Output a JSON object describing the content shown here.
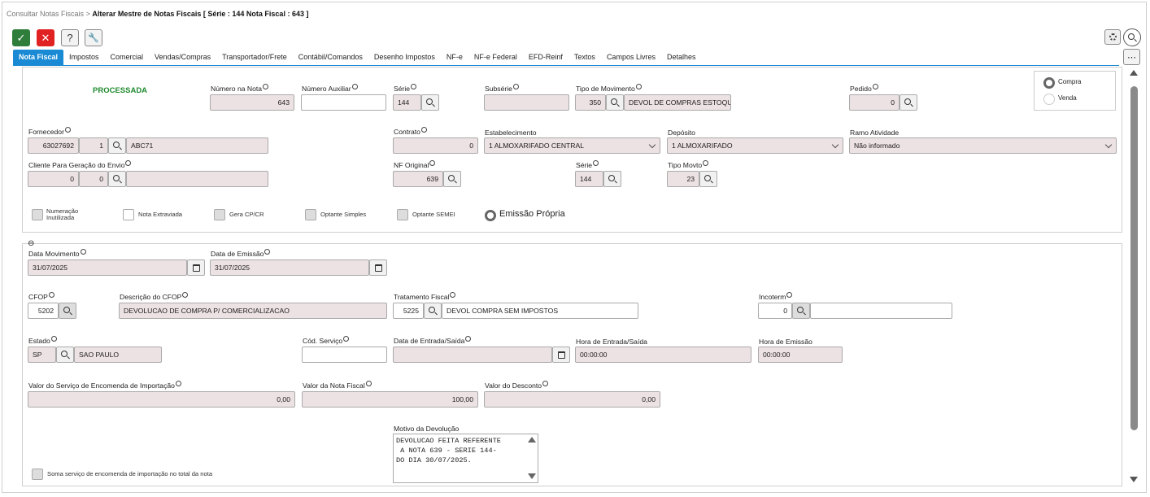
{
  "breadcrumb": {
    "parent": "Consultar Notas Fiscais",
    "sep": ">",
    "current": "Alterar Mestre de Notas Fiscais [ Série : 144 Nota Fiscal : 643 ]"
  },
  "toolbar": {
    "confirm": "✓",
    "cancel": "✕",
    "help": "?",
    "tools": "🔧",
    "more": "⋯"
  },
  "tabs": [
    "Nota Fiscal",
    "Impostos",
    "Comercial",
    "Vendas/Compras",
    "Transportador/Frete",
    "Contábil/Comandos",
    "Desenho Impostos",
    "NF-e",
    "NF-e Federal",
    "EFD-Reinf",
    "Textos",
    "Campos Livres",
    "Detalhes"
  ],
  "header": {
    "status": "PROCESSADA",
    "numero_nota": {
      "label": "Número na Nota",
      "value": "643"
    },
    "numero_auxiliar": {
      "label": "Número Auxiliar",
      "value": ""
    },
    "serie": {
      "label": "Série",
      "value": "144"
    },
    "subserie": {
      "label": "Subsérie",
      "value": ""
    },
    "tipo_movimento": {
      "label": "Tipo de Movimento",
      "code": "350",
      "desc": "DEVOL DE COMPRAS ESTOQUE"
    },
    "pedido": {
      "label": "Pedido",
      "value": "0"
    },
    "radio_compra": "Compra",
    "radio_venda": "Venda",
    "fornecedor": {
      "label": "Fornecedor",
      "code": "63027692",
      "seq": "1",
      "name": "ABC71"
    },
    "contrato": {
      "label": "Contrato",
      "value": "0"
    },
    "estabelecimento": {
      "label": "Estabelecimento",
      "value": "1 ALMOXARIFADO CENTRAL"
    },
    "deposito": {
      "label": "Depósito",
      "value": "1 ALMOXARIFADO"
    },
    "ramo": {
      "label": "Ramo Atividade",
      "value": "Não informado"
    },
    "cliente_envio": {
      "label": "Cliente Para Geração do Envio",
      "code": "0",
      "seq": "0",
      "name": ""
    },
    "nf_original": {
      "label": "NF Original",
      "value": "639"
    },
    "serie2": {
      "label": "Série",
      "value": "144"
    },
    "tipo_movto": {
      "label": "Tipo Movto",
      "value": "23"
    },
    "cb_numeracao_1": "Numeração",
    "cb_numeracao_2": "Inutilizada",
    "cb_extraviada": "Nota Extraviada",
    "cb_gera": "Gera CP/CR",
    "cb_simples": "Optante Simples",
    "cb_semei": "Optante SEMEI",
    "emissao_propria": "Emissão Própria"
  },
  "detail": {
    "collapse": "⊖",
    "data_movimento": {
      "label": "Data Movimento",
      "value": "31/07/2025"
    },
    "data_emissao": {
      "label": "Data de Emissão",
      "value": "31/07/2025"
    },
    "cfop": {
      "label": "CFOP",
      "value": "5202"
    },
    "desc_cfop": {
      "label": "Descrição do CFOP",
      "value": "DEVOLUCAO DE COMPRA P/ COMERCIALIZACAO"
    },
    "tratamento": {
      "label": "Tratamento Fiscal",
      "code": "5225",
      "desc": "DEVOL COMPRA SEM IMPOSTOS"
    },
    "incoterm": {
      "label": "Incoterm",
      "code": "0",
      "desc": ""
    },
    "estado": {
      "label": "Estado",
      "code": "SP",
      "name": "SAO PAULO"
    },
    "cod_servico": {
      "label": "Cód. Serviço",
      "value": ""
    },
    "data_entrada": {
      "label": "Data de Entrada/Saída",
      "value": ""
    },
    "hora_entrada": {
      "label": "Hora de Entrada/Saída",
      "value": "00:00:00"
    },
    "hora_emissao": {
      "label": "Hora de Emissão",
      "value": "00:00:00"
    },
    "valor_servico": {
      "label": "Valor do Serviço de Encomenda de Importação",
      "value": "0,00"
    },
    "valor_nota": {
      "label": "Valor da Nota Fiscal",
      "value": "100,00"
    },
    "valor_desconto": {
      "label": "Valor do Desconto",
      "value": "0,00"
    },
    "motivo": {
      "label": "Motivo da Devolução",
      "value": "DEVOLUCAO FEITA REFERENTE\n A NOTA 639 - SERIE 144-\nDO DIA 30/07/2025."
    },
    "cb_soma": "Soma serviço de encomenda de importação no total da nota"
  }
}
